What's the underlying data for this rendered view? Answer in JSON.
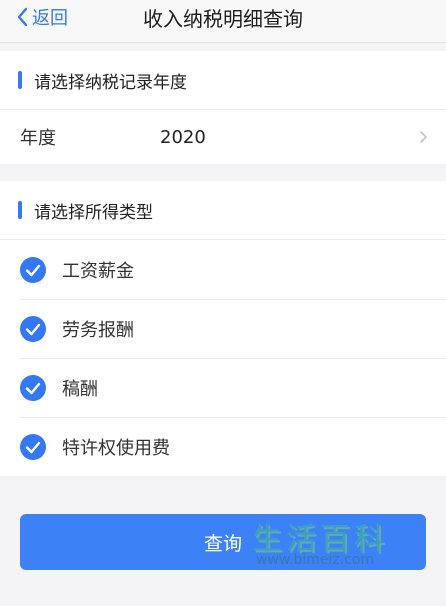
{
  "navbar": {
    "back_label": "返回",
    "title": "收入纳税明细查询"
  },
  "year_section": {
    "heading": "请选择纳税记录年度",
    "row_label": "年度",
    "row_value": "2020"
  },
  "type_section": {
    "heading": "请选择所得类型",
    "options": [
      {
        "label": "工资薪金",
        "checked": true
      },
      {
        "label": "劳务报酬",
        "checked": true
      },
      {
        "label": "稿酬",
        "checked": true
      },
      {
        "label": "特许权使用费",
        "checked": true
      }
    ]
  },
  "query_button_label": "查询",
  "watermark": {
    "text": "生活百科",
    "url": "www.bimeiz.com"
  },
  "colors": {
    "accent": "#3478f6",
    "button": "#3c82f6",
    "background": "#f4f4f6"
  }
}
